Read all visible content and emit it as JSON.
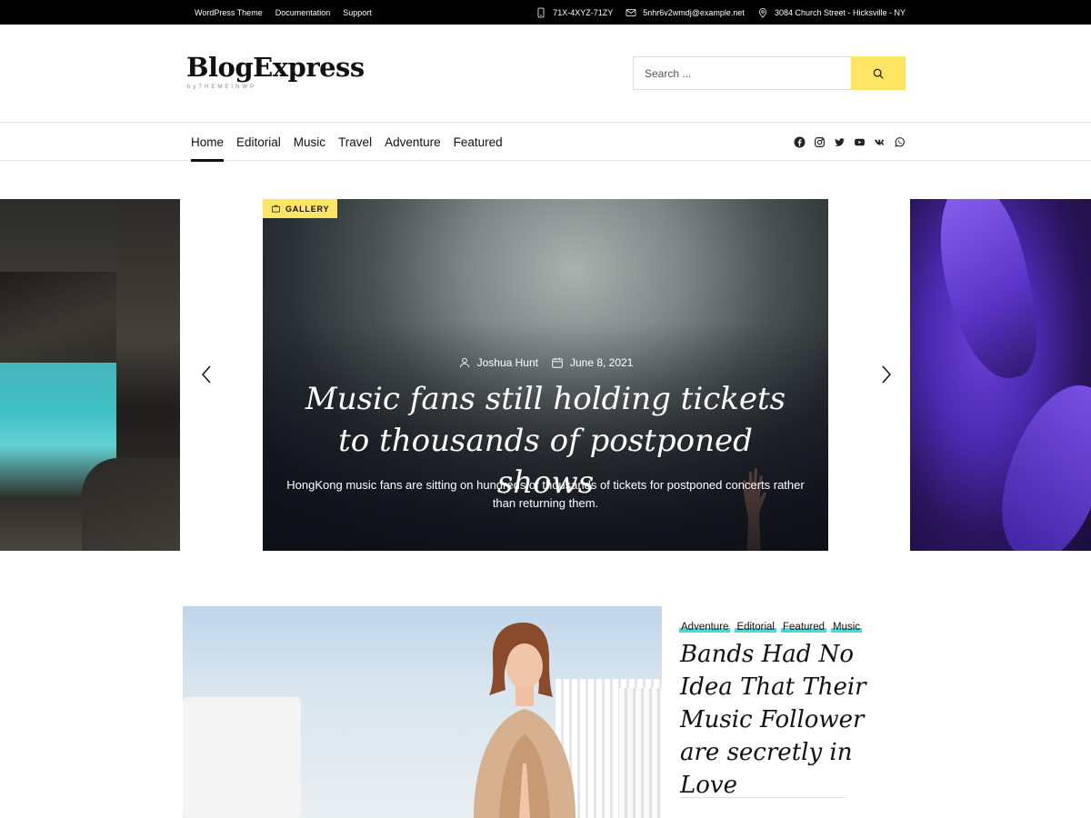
{
  "topbar": {
    "links": [
      "WordPress Theme",
      "Documentation",
      "Support"
    ],
    "phone": "71X-4XYZ-71ZY",
    "email": "5nhr6v2wmdj@example.net",
    "address": "3084 Church Street - Hicksville - NY"
  },
  "header": {
    "logo": "BlogExpress",
    "logo_sub": "byTHEMEINWP",
    "search_placeholder": "Search ..."
  },
  "nav": {
    "items": [
      {
        "label": "Home",
        "active": true
      },
      {
        "label": "Editorial"
      },
      {
        "label": "Music"
      },
      {
        "label": "Travel"
      },
      {
        "label": "Adventure"
      },
      {
        "label": "Featured"
      }
    ],
    "social": [
      "facebook-icon",
      "instagram-icon",
      "twitter-icon",
      "youtube-icon",
      "vk-icon",
      "whatsapp-icon"
    ]
  },
  "slider": {
    "badge": "GALLERY",
    "author": "Joshua Hunt",
    "date": "June 8, 2021",
    "title": "Music fans still holding tickets to thousands of postponed shows",
    "excerpt": "HongKong music fans are sitting on hundreds of thousands of tickets for postponed concerts rather than returning them."
  },
  "featured_post": {
    "categories": [
      "Adventure",
      "Editorial",
      "Featured",
      "Music"
    ],
    "title": "Bands Had No Idea That Their Music Follower are secretly in Love"
  },
  "colors": {
    "accent": "#ffe563",
    "category_underline": "#3de0d8",
    "topbar": "#000000"
  }
}
